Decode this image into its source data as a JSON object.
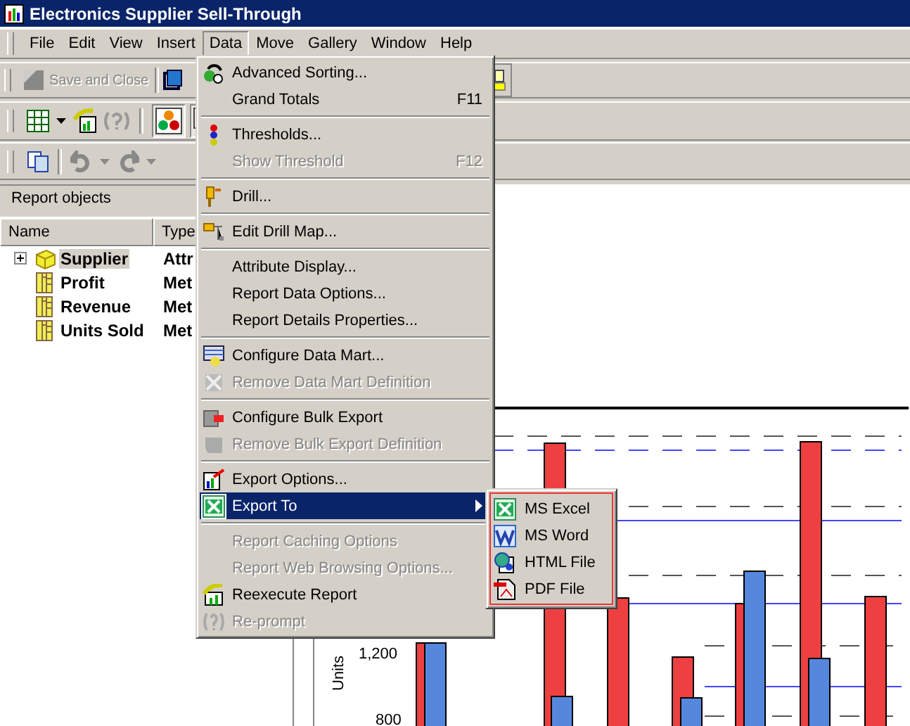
{
  "window": {
    "title": "Electronics Supplier Sell-Through"
  },
  "menu_bar": [
    {
      "label": "File",
      "selected": false
    },
    {
      "label": "Edit",
      "selected": false
    },
    {
      "label": "View",
      "selected": false
    },
    {
      "label": "Insert",
      "selected": false
    },
    {
      "label": "Data",
      "selected": true
    },
    {
      "label": "Move",
      "selected": false
    },
    {
      "label": "Gallery",
      "selected": false
    },
    {
      "label": "Window",
      "selected": false
    },
    {
      "label": "Help",
      "selected": false
    }
  ],
  "toolbar": {
    "save_button": {
      "label": "Save and Close",
      "disabled": true
    }
  },
  "report_objects": {
    "title": "Report objects",
    "columns": [
      "Name",
      "Type"
    ],
    "rows": [
      {
        "kind": "attribute",
        "name": "Supplier",
        "type": "Attr",
        "expanded": false,
        "selected": true
      },
      {
        "kind": "metric",
        "name": "Profit",
        "type": "Met",
        "selected": false
      },
      {
        "kind": "metric",
        "name": "Revenue",
        "type": "Met",
        "selected": false
      },
      {
        "kind": "metric",
        "name": "Units Sold",
        "type": "Met",
        "selected": false
      }
    ]
  },
  "chart": {
    "axis_label": "Units",
    "ticks": [
      "1,200",
      "800"
    ]
  },
  "data_menu": [
    {
      "kind": "item",
      "label": "Advanced Sorting...",
      "disabled": false,
      "selected": false
    },
    {
      "kind": "item",
      "label": "Grand Totals",
      "shortcut": "F11",
      "disabled": false,
      "selected": false
    },
    {
      "kind": "separator"
    },
    {
      "kind": "item",
      "label": "Thresholds...",
      "disabled": false,
      "selected": false
    },
    {
      "kind": "item",
      "label": "Show Threshold",
      "shortcut": "F12",
      "disabled": true,
      "selected": false
    },
    {
      "kind": "separator"
    },
    {
      "kind": "item",
      "label": "Drill...",
      "disabled": false,
      "selected": false
    },
    {
      "kind": "separator"
    },
    {
      "kind": "item",
      "label": "Edit Drill Map...",
      "disabled": false,
      "selected": false
    },
    {
      "kind": "separator"
    },
    {
      "kind": "item",
      "label": "Attribute Display...",
      "disabled": false,
      "selected": false
    },
    {
      "kind": "item",
      "label": "Report Data Options...",
      "disabled": false,
      "selected": false
    },
    {
      "kind": "item",
      "label": "Report Details Properties...",
      "disabled": false,
      "selected": false
    },
    {
      "kind": "separator"
    },
    {
      "kind": "item",
      "label": "Configure Data Mart...",
      "disabled": false,
      "selected": false
    },
    {
      "kind": "item",
      "label": "Remove Data Mart Definition",
      "disabled": true,
      "selected": false
    },
    {
      "kind": "separator"
    },
    {
      "kind": "item",
      "label": "Configure Bulk Export",
      "disabled": false,
      "selected": false
    },
    {
      "kind": "item",
      "label": "Remove Bulk Export Definition",
      "disabled": true,
      "selected": false
    },
    {
      "kind": "separator"
    },
    {
      "kind": "item",
      "label": "Export Options...",
      "disabled": false,
      "selected": false
    },
    {
      "kind": "item",
      "label": "Export To",
      "disabled": false,
      "selected": true,
      "submenu": true
    },
    {
      "kind": "separator"
    },
    {
      "kind": "item",
      "label": "Report Caching Options",
      "disabled": true,
      "selected": false
    },
    {
      "kind": "item",
      "label": "Report Web Browsing Options...",
      "disabled": true,
      "selected": false
    },
    {
      "kind": "item",
      "label": "Reexecute Report",
      "disabled": false,
      "selected": false
    },
    {
      "kind": "item",
      "label": "Re-prompt",
      "disabled": true,
      "selected": false
    }
  ],
  "export_submenu": [
    {
      "label": "MS Excel"
    },
    {
      "label": "MS Word"
    },
    {
      "label": "HTML File"
    },
    {
      "label": "PDF File"
    }
  ]
}
